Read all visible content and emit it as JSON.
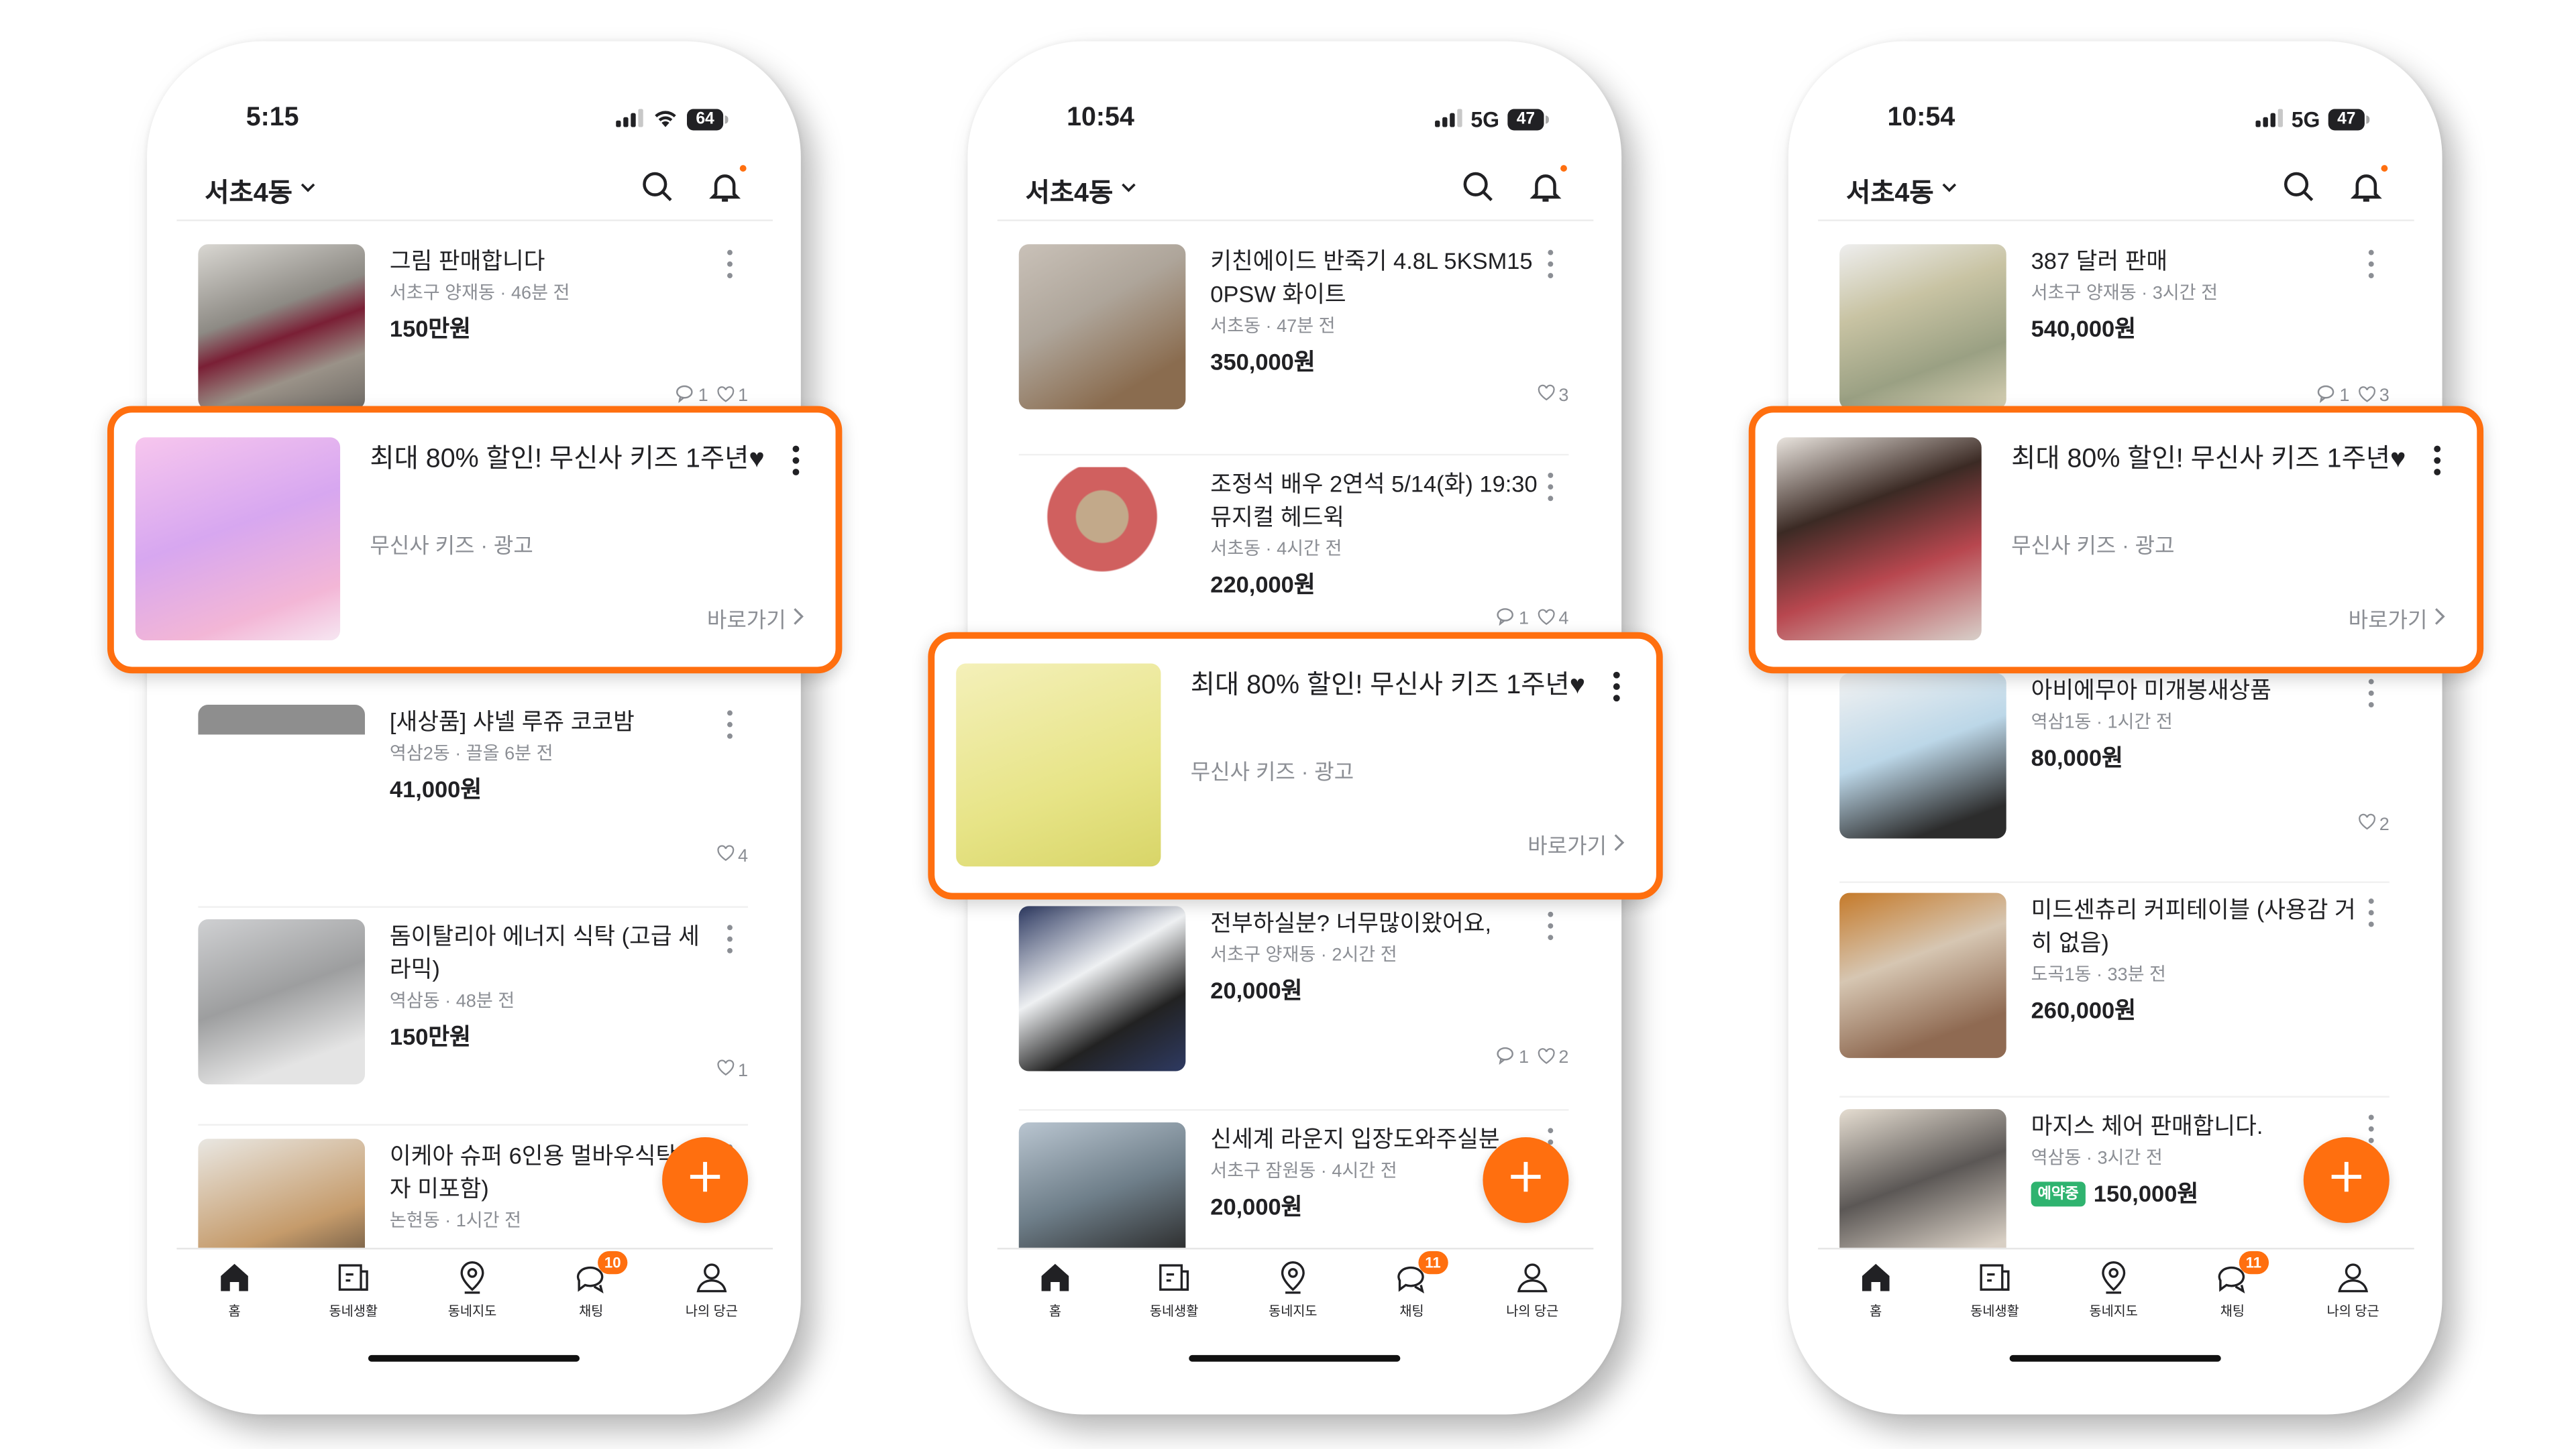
{
  "accent_color": "#FF6F0F",
  "nav": [
    "홈",
    "동네생활",
    "동네지도",
    "채팅",
    "나의 당근"
  ],
  "ad": {
    "title": "최대 80% 할인! 무신사 키즈 1주년♥",
    "subtitle": "무신사 키즈 · 광고",
    "cta": "바로가기"
  },
  "phones": [
    {
      "status": {
        "time": "5:15",
        "network": "wifi",
        "battery": "64"
      },
      "location": "서초4동",
      "chat_badge": "10",
      "listings": [
        {
          "title": "그림 판매합니다",
          "meta": "서초구 양재동 · 46분 전",
          "price": "150만원",
          "comments": "1",
          "likes": "1"
        },
        {
          "title": "[새상품] 샤넬 루쥬 코코밤",
          "meta": "역삼2동 · 끌올 6분 전",
          "price": "41,000원",
          "likes": "4"
        },
        {
          "title": "돔이탈리아 에너지 식탁 (고급 세라믹)",
          "meta": "역삼동 · 48분 전",
          "price": "150만원",
          "likes": "1"
        },
        {
          "title": "이케아 슈퍼 6인용 멀바우식탁 (의자 미포함)",
          "meta": "논현동 · 1시간 전",
          "price": ""
        }
      ]
    },
    {
      "status": {
        "time": "10:54",
        "network": "5G",
        "battery": "47"
      },
      "location": "서초4동",
      "chat_badge": "11",
      "listings": [
        {
          "title": "키친에이드 반죽기 4.8L 5KSM150PSW 화이트",
          "meta": "서초동 · 47분 전",
          "price": "350,000원",
          "likes": "3"
        },
        {
          "title": "조정석 배우 2연석 5/14(화) 19:30 뮤지컬 헤드윅",
          "meta": "서초동 · 4시간 전",
          "price": "220,000원",
          "comments": "1",
          "likes": "4"
        },
        {
          "title": "전부하실분? 너무많이왔어요,",
          "meta": "서초구 양재동 · 2시간 전",
          "price": "20,000원",
          "comments": "1",
          "likes": "2"
        },
        {
          "title": "신세계 라운지 입장도와주실분",
          "meta": "서초구 잠원동 · 4시간 전",
          "price": "20,000원"
        }
      ]
    },
    {
      "status": {
        "time": "10:54",
        "network": "5G",
        "battery": "47"
      },
      "location": "서초4동",
      "chat_badge": "11",
      "listings": [
        {
          "title": "387 달러 판매",
          "meta": "서초구 양재동 · 3시간 전",
          "price": "540,000원",
          "comments": "1",
          "likes": "3"
        },
        {
          "title": "아비에무아 미개봉새상품",
          "meta": "역삼1동 · 1시간 전",
          "price": "80,000원",
          "likes": "2"
        },
        {
          "title": "미드센츄리 커피테이블 (사용감 거히 없음)",
          "meta": "도곡1동 · 33분 전",
          "price": "260,000원"
        },
        {
          "title": "마지스 체어 판매합니다.",
          "meta": "역삼동 · 3시간 전",
          "price": "150,000원",
          "badge": "예약중"
        }
      ]
    }
  ]
}
